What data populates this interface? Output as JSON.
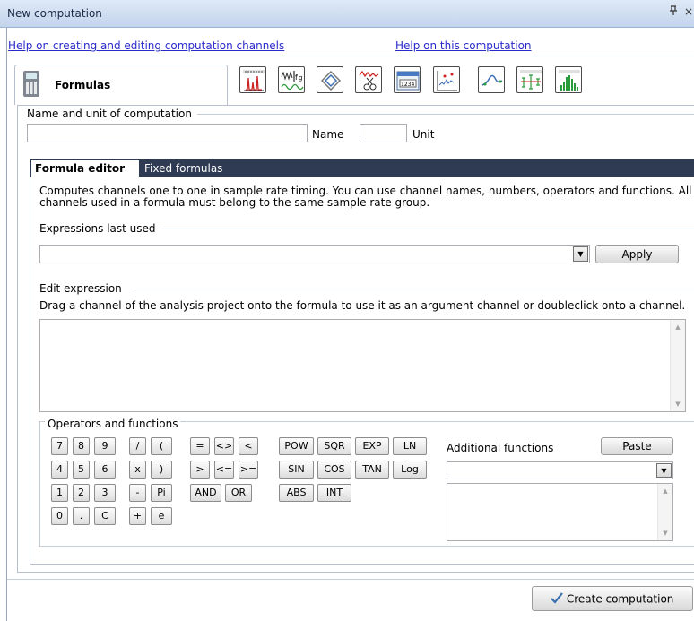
{
  "window": {
    "title": "New computation",
    "pin_glyph": "t",
    "close_glyph": "×"
  },
  "links": {
    "help_channels": "Help on creating and editing computation channels",
    "help_computation": "Help on this computation"
  },
  "tabs": {
    "formulas": "Formulas",
    "tool_icons": [
      "spectrum-icon",
      "waveform-fg-icon",
      "cycle-icon",
      "cut-icon",
      "numeric-display-icon",
      "scatter-icon",
      "curve-icon",
      "statistics-icon",
      "histogram-icon"
    ]
  },
  "name_unit": {
    "legend": "Name and unit of computation",
    "name_label": "Name",
    "unit_label": "Unit",
    "name_value": "",
    "unit_value": ""
  },
  "editor_tabs": {
    "active": "Formula editor",
    "inactive": "Fixed formulas"
  },
  "description": "Computes channels one to one in sample rate timing. You can use channel names, numbers, operators and functions. All channels used in a formula must belong to the same sample rate group.",
  "last_used": {
    "legend": "Expressions last used",
    "value": "",
    "apply": "Apply"
  },
  "edit_expr": {
    "legend": "Edit expression",
    "hint": "Drag a channel of the analysis project onto the formula to use it as an argument channel or doubleclick onto a channel.",
    "value": ""
  },
  "operators": {
    "legend": "Operators and functions",
    "digits": [
      "7",
      "8",
      "9",
      "4",
      "5",
      "6",
      "1",
      "2",
      "3",
      "0",
      ".",
      "C"
    ],
    "arith": [
      "/",
      "(",
      "x",
      ")",
      "-",
      "Pi",
      "+",
      "e"
    ],
    "compare": [
      "=",
      "<>",
      "<",
      ">",
      "<=",
      ">=",
      "AND",
      "OR"
    ],
    "funcs": [
      "POW",
      "SQR",
      "EXP",
      "LN",
      "SIN",
      "COS",
      "TAN",
      "Log",
      "ABS",
      "INT"
    ],
    "additional_label": "Additional functions",
    "paste": "Paste",
    "additional_value": ""
  },
  "footer": {
    "create": "Create computation"
  },
  "colors": {
    "titlebar": "#c9d9ef",
    "tab_strip": "#2f3b52",
    "link": "#2a2acb"
  }
}
